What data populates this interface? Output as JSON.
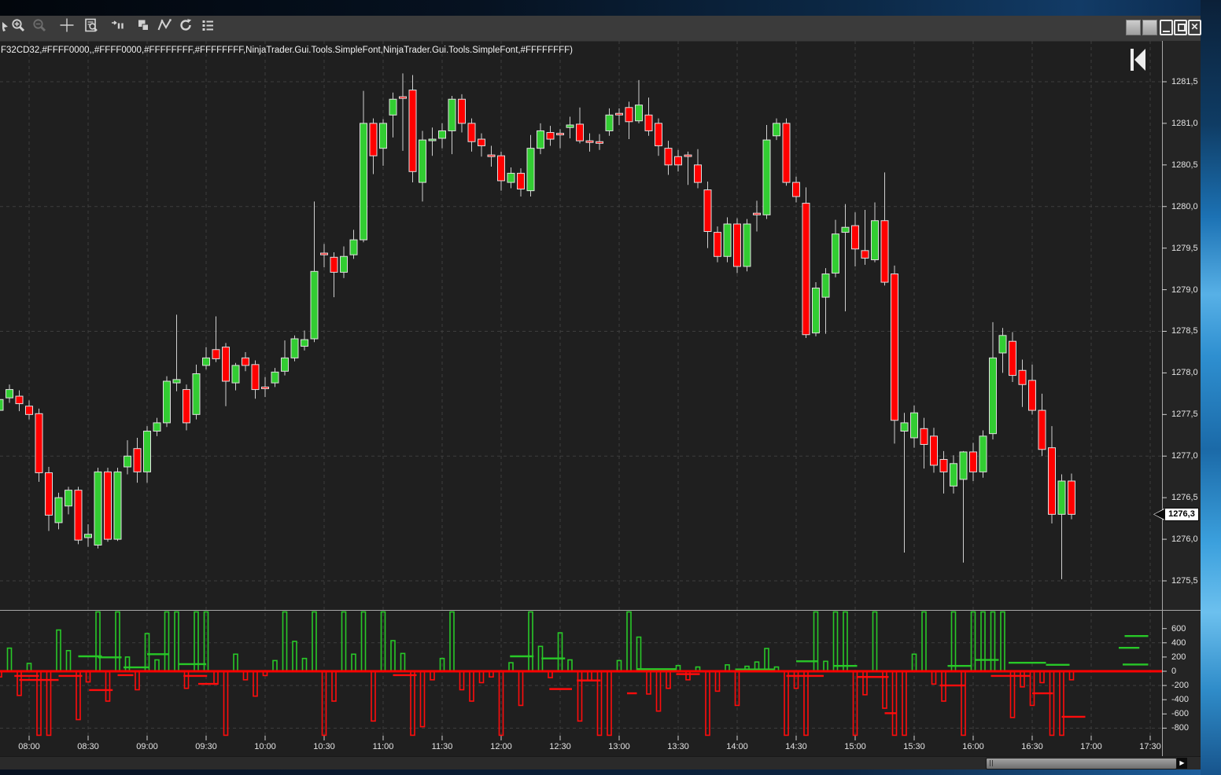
{
  "window": {
    "buttons": [
      {
        "name": "titlebar-button-1"
      },
      {
        "name": "titlebar-button-2"
      },
      {
        "name": "minimize"
      },
      {
        "name": "restore"
      },
      {
        "name": "close"
      }
    ]
  },
  "toolbar": {
    "icons": [
      {
        "name": "zoom-in",
        "disabled": false
      },
      {
        "name": "zoom-out",
        "disabled": true
      },
      {
        "name": "crosshair",
        "disabled": false
      },
      {
        "name": "chart-inspector",
        "disabled": false
      },
      {
        "name": "bar-period",
        "disabled": false
      },
      {
        "name": "windows-cascade",
        "disabled": false
      },
      {
        "name": "drawing-tools",
        "disabled": false
      },
      {
        "name": "reload",
        "disabled": false
      },
      {
        "name": "data-series",
        "disabled": false
      }
    ]
  },
  "chart": {
    "config_text": "F32CD32,#FFFF0000,,#FFFF0000,#FFFFFFFF,#FFFFFFFF,NinjaTrader.Gui.Tools.SimpleFont,NinjaTrader.Gui.Tools.SimpleFont,#FFFFFFFF)",
    "last_price_label": "1276,3"
  },
  "scrollbar": {
    "right_arrow_glyph": "▶"
  },
  "chart_data": {
    "type": "candlestick",
    "title": "",
    "decimal_separator": ",",
    "colors": {
      "up": "#32CD32",
      "down": "#FF0000",
      "outline": "#E0E0E0",
      "wick": "#CFCFCF",
      "delta_up": "#28C828",
      "delta_down": "#FF0C0C",
      "zero_line": "#FF0000",
      "grid": "#3E3E3E",
      "background": "#1F1F1F",
      "axis_text": "#E3E3E3"
    },
    "time_axis": {
      "labels": [
        "08:00",
        "08:30",
        "09:00",
        "09:30",
        "10:00",
        "10:30",
        "11:00",
        "11:30",
        "12:00",
        "12:30",
        "13:00",
        "13:30",
        "14:00",
        "14:30",
        "15:00",
        "15:30",
        "16:00",
        "16:30",
        "17:00",
        "17:30"
      ],
      "minor_step_minutes": 5
    },
    "price_axis": {
      "ticks": [
        1281.5,
        1281.0,
        1280.5,
        1280.0,
        1279.5,
        1279.0,
        1278.5,
        1278.0,
        1277.5,
        1277.0,
        1276.5,
        1276.0,
        1275.5
      ],
      "gridlines": [
        1281.5,
        1280.0,
        1278.5,
        1277.0,
        1275.5
      ],
      "last_price": 1276.3
    },
    "columns": [
      "time",
      "open",
      "high",
      "low",
      "close"
    ],
    "candles": [
      [
        "07:45",
        1277.55,
        1277.75,
        1277.48,
        1277.68
      ],
      [
        "07:50",
        1277.7,
        1277.86,
        1277.64,
        1277.8
      ],
      [
        "07:55",
        1277.72,
        1277.79,
        1277.54,
        1277.63
      ],
      [
        "08:00",
        1277.6,
        1277.67,
        1277.44,
        1277.5
      ],
      [
        "08:05",
        1277.51,
        1277.57,
        1276.69,
        1276.8
      ],
      [
        "08:10",
        1276.8,
        1276.87,
        1276.1,
        1276.29
      ],
      [
        "08:15",
        1276.2,
        1276.56,
        1276.12,
        1276.5
      ],
      [
        "08:20",
        1276.4,
        1276.63,
        1276.3,
        1276.59
      ],
      [
        "08:25",
        1276.59,
        1276.63,
        1275.94,
        1275.99
      ],
      [
        "08:30",
        1276.02,
        1276.18,
        1275.91,
        1276.06
      ],
      [
        "08:35",
        1275.93,
        1276.86,
        1275.89,
        1276.81
      ],
      [
        "08:40",
        1276.81,
        1276.86,
        1275.97,
        1276.0
      ],
      [
        "08:45",
        1276.0,
        1276.86,
        1275.98,
        1276.81
      ],
      [
        "08:50",
        1276.87,
        1277.19,
        1276.78,
        1277.0
      ],
      [
        "08:55",
        1277.09,
        1277.22,
        1276.68,
        1276.81
      ],
      [
        "09:00",
        1276.81,
        1277.36,
        1276.68,
        1277.3
      ],
      [
        "09:05",
        1277.3,
        1277.46,
        1277.24,
        1277.4
      ],
      [
        "09:10",
        1277.4,
        1277.96,
        1277.35,
        1277.9
      ],
      [
        "09:15",
        1277.88,
        1278.7,
        1277.78,
        1277.92
      ],
      [
        "09:20",
        1277.8,
        1277.86,
        1277.31,
        1277.4
      ],
      [
        "09:25",
        1277.5,
        1278.1,
        1277.44,
        1277.99
      ],
      [
        "09:30",
        1278.09,
        1278.31,
        1278.04,
        1278.18
      ],
      [
        "09:35",
        1278.28,
        1278.68,
        1278.13,
        1278.17
      ],
      [
        "09:40",
        1278.31,
        1278.36,
        1277.6,
        1277.9
      ],
      [
        "09:45",
        1277.88,
        1278.12,
        1277.79,
        1278.09
      ],
      [
        "09:50",
        1278.18,
        1278.25,
        1278.02,
        1278.09
      ],
      [
        "09:55",
        1278.1,
        1278.15,
        1277.69,
        1277.8
      ],
      [
        "10:00",
        1277.83,
        1277.95,
        1277.71,
        1277.81
      ],
      [
        "10:05",
        1277.88,
        1278.06,
        1277.83,
        1278.01
      ],
      [
        "10:10",
        1278.02,
        1278.39,
        1277.97,
        1278.18
      ],
      [
        "10:15",
        1278.18,
        1278.45,
        1278.14,
        1278.41
      ],
      [
        "10:20",
        1278.32,
        1278.51,
        1278.27,
        1278.4
      ],
      [
        "10:25",
        1278.41,
        1280.06,
        1278.37,
        1279.22
      ],
      [
        "10:30",
        1279.44,
        1279.55,
        1279.27,
        1279.42
      ],
      [
        "10:35",
        1279.39,
        1279.45,
        1278.91,
        1279.21
      ],
      [
        "10:40",
        1279.21,
        1279.52,
        1279.14,
        1279.4
      ],
      [
        "10:45",
        1279.42,
        1279.72,
        1279.37,
        1279.6
      ],
      [
        "10:50",
        1279.6,
        1281.39,
        1279.57,
        1281.0
      ],
      [
        "10:55",
        1281.0,
        1281.06,
        1280.39,
        1280.61
      ],
      [
        "11:00",
        1280.7,
        1281.05,
        1280.49,
        1281.0
      ],
      [
        "11:05",
        1281.1,
        1281.37,
        1280.83,
        1281.29
      ],
      [
        "11:10",
        1281.32,
        1281.6,
        1280.67,
        1281.3
      ],
      [
        "11:15",
        1281.4,
        1281.58,
        1280.29,
        1280.42
      ],
      [
        "11:20",
        1280.29,
        1280.91,
        1280.06,
        1280.8
      ],
      [
        "11:25",
        1280.8,
        1280.95,
        1280.61,
        1280.81
      ],
      [
        "11:30",
        1280.82,
        1281.0,
        1280.7,
        1280.91
      ],
      [
        "11:35",
        1280.91,
        1281.33,
        1280.63,
        1281.29
      ],
      [
        "11:40",
        1281.29,
        1281.35,
        1280.89,
        1281.0
      ],
      [
        "11:45",
        1281.0,
        1281.06,
        1280.66,
        1280.78
      ],
      [
        "11:50",
        1280.81,
        1280.88,
        1280.6,
        1280.73
      ],
      [
        "11:55",
        1280.62,
        1280.73,
        1280.48,
        1280.6
      ],
      [
        "12:00",
        1280.61,
        1280.66,
        1280.19,
        1280.31
      ],
      [
        "12:05",
        1280.29,
        1280.47,
        1280.22,
        1280.4
      ],
      [
        "12:10",
        1280.4,
        1280.46,
        1280.12,
        1280.21
      ],
      [
        "12:15",
        1280.19,
        1280.86,
        1280.12,
        1280.7
      ],
      [
        "12:20",
        1280.7,
        1281.0,
        1280.63,
        1280.91
      ],
      [
        "12:25",
        1280.89,
        1280.97,
        1280.73,
        1280.81
      ],
      [
        "12:30",
        1280.88,
        1280.93,
        1280.7,
        1280.87
      ],
      [
        "12:35",
        1280.95,
        1281.08,
        1280.82,
        1280.98
      ],
      [
        "12:40",
        1280.99,
        1281.19,
        1280.76,
        1280.79
      ],
      [
        "12:45",
        1280.79,
        1280.88,
        1280.66,
        1280.77
      ],
      [
        "12:50",
        1280.78,
        1280.87,
        1280.68,
        1280.76
      ],
      [
        "12:55",
        1280.91,
        1281.18,
        1280.85,
        1281.1
      ],
      [
        "13:00",
        1281.12,
        1281.18,
        1280.98,
        1281.11
      ],
      [
        "13:05",
        1281.19,
        1281.26,
        1280.81,
        1281.02
      ],
      [
        "13:10",
        1281.03,
        1281.52,
        1281.0,
        1281.22
      ],
      [
        "13:15",
        1281.1,
        1281.31,
        1280.85,
        1280.91
      ],
      [
        "13:20",
        1281.0,
        1281.06,
        1280.61,
        1280.73
      ],
      [
        "13:25",
        1280.7,
        1280.79,
        1280.38,
        1280.5
      ],
      [
        "13:30",
        1280.6,
        1280.68,
        1280.42,
        1280.5
      ],
      [
        "13:35",
        1280.62,
        1280.66,
        1280.26,
        1280.61
      ],
      [
        "13:40",
        1280.5,
        1280.69,
        1280.22,
        1280.29
      ],
      [
        "13:45",
        1280.2,
        1280.3,
        1279.5,
        1279.7
      ],
      [
        "13:50",
        1279.69,
        1279.76,
        1279.33,
        1279.4
      ],
      [
        "13:55",
        1279.4,
        1279.87,
        1279.33,
        1279.79
      ],
      [
        "14:00",
        1279.79,
        1279.86,
        1279.2,
        1279.28
      ],
      [
        "14:05",
        1279.28,
        1279.85,
        1279.22,
        1279.79
      ],
      [
        "14:10",
        1279.92,
        1280.07,
        1279.7,
        1279.9
      ],
      [
        "14:15",
        1279.9,
        1280.98,
        1279.85,
        1280.8
      ],
      [
        "14:20",
        1280.85,
        1281.06,
        1280.8,
        1281.0
      ],
      [
        "14:25",
        1281.0,
        1281.06,
        1280.25,
        1280.29
      ],
      [
        "14:30",
        1280.29,
        1280.36,
        1280.05,
        1280.12
      ],
      [
        "14:35",
        1280.04,
        1280.23,
        1278.42,
        1278.46
      ],
      [
        "14:40",
        1278.48,
        1279.09,
        1278.44,
        1279.02
      ],
      [
        "14:45",
        1278.91,
        1279.26,
        1278.47,
        1279.19
      ],
      [
        "14:50",
        1279.2,
        1279.84,
        1279.15,
        1279.67
      ],
      [
        "14:55",
        1279.69,
        1280.03,
        1278.74,
        1279.75
      ],
      [
        "15:00",
        1279.77,
        1279.93,
        1279.28,
        1279.49
      ],
      [
        "15:05",
        1279.47,
        1279.96,
        1279.3,
        1279.38
      ],
      [
        "15:10",
        1279.36,
        1280.05,
        1279.33,
        1279.83
      ],
      [
        "15:15",
        1279.83,
        1280.41,
        1279.05,
        1279.09
      ],
      [
        "15:20",
        1279.19,
        1279.29,
        1277.15,
        1277.43
      ],
      [
        "15:25",
        1277.3,
        1277.52,
        1275.84,
        1277.4
      ],
      [
        "15:30",
        1277.22,
        1277.61,
        1277.1,
        1277.52
      ],
      [
        "15:35",
        1277.33,
        1277.46,
        1276.85,
        1277.14
      ],
      [
        "15:40",
        1277.24,
        1277.34,
        1276.8,
        1276.89
      ],
      [
        "15:45",
        1276.96,
        1277.06,
        1276.55,
        1276.81
      ],
      [
        "15:50",
        1276.64,
        1277.01,
        1276.55,
        1276.91
      ],
      [
        "15:55",
        1276.72,
        1277.06,
        1275.72,
        1277.05
      ],
      [
        "16:00",
        1277.05,
        1277.16,
        1276.7,
        1276.81
      ],
      [
        "16:05",
        1276.81,
        1277.31,
        1276.74,
        1277.24
      ],
      [
        "16:10",
        1277.27,
        1278.61,
        1277.2,
        1278.18
      ],
      [
        "16:15",
        1278.24,
        1278.54,
        1278.0,
        1278.45
      ],
      [
        "16:20",
        1278.38,
        1278.49,
        1277.89,
        1277.97
      ],
      [
        "16:25",
        1278.03,
        1278.16,
        1277.59,
        1277.86
      ],
      [
        "16:30",
        1277.91,
        1278.1,
        1277.5,
        1277.55
      ],
      [
        "16:35",
        1277.55,
        1277.75,
        1277.0,
        1277.08
      ],
      [
        "16:40",
        1277.1,
        1277.36,
        1276.19,
        1276.3
      ],
      [
        "16:45",
        1276.3,
        1276.78,
        1275.52,
        1276.7
      ],
      [
        "16:50",
        1276.7,
        1276.79,
        1276.24,
        1276.3
      ]
    ],
    "lower_panel": {
      "type": "delta-bars",
      "ticks": [
        600,
        400,
        200,
        0,
        -200,
        -400,
        -600,
        -800
      ],
      "gridlines": [
        400,
        -200,
        -800
      ],
      "clip_value": 900,
      "values": [
        -80,
        325,
        -340,
        110,
        -900,
        -900,
        580,
        290,
        -680,
        -150,
        900,
        -420,
        900,
        200,
        -260,
        530,
        160,
        900,
        900,
        -240,
        900,
        900,
        -180,
        -900,
        240,
        -120,
        -350,
        -60,
        150,
        900,
        420,
        180,
        900,
        -900,
        -420,
        900,
        240,
        900,
        -700,
        900,
        430,
        250,
        -900,
        -780,
        -120,
        180,
        900,
        -260,
        -420,
        -160,
        -80,
        -900,
        120,
        -480,
        900,
        350,
        -90,
        540,
        160,
        -700,
        -130,
        -900,
        -900,
        150,
        900,
        480,
        -320,
        -560,
        -240,
        80,
        -120,
        60,
        -900,
        -280,
        90,
        -480,
        70,
        130,
        320,
        60,
        -900,
        -240,
        -900,
        900,
        140,
        900,
        900,
        -900,
        -330,
        900,
        -520,
        -900,
        -900,
        240,
        900,
        -180,
        -420,
        900,
        -900,
        900,
        900,
        900,
        900,
        -650,
        -220,
        -480,
        -160,
        -900,
        -900,
        -120
      ],
      "segments": [
        [
          1.5,
          4.0,
          -66
        ],
        [
          2.0,
          6.0,
          -122
        ],
        [
          6.0,
          8.4,
          -66
        ],
        [
          9.1,
          11.5,
          -265
        ],
        [
          12.0,
          13.6,
          -55
        ],
        [
          18.7,
          21.1,
          -66
        ],
        [
          20.2,
          22.2,
          -177
        ],
        [
          8.0,
          10.4,
          210
        ],
        [
          10.0,
          12.4,
          195
        ],
        [
          12.6,
          15.2,
          55
        ],
        [
          15.0,
          17.2,
          240
        ],
        [
          18.2,
          21.0,
          100
        ],
        [
          40.0,
          42.4,
          -55
        ],
        [
          51.9,
          54.3,
          210
        ],
        [
          55.1,
          57.5,
          180
        ],
        [
          55.9,
          58.2,
          -250
        ],
        [
          58.7,
          61.1,
          -130
        ],
        [
          63.8,
          64.8,
          -310
        ],
        [
          64.8,
          68.8,
          30
        ],
        [
          68.8,
          71.2,
          -40
        ],
        [
          74.8,
          78.8,
          25
        ],
        [
          80.0,
          83.8,
          -66
        ],
        [
          81.0,
          83.2,
          140
        ],
        [
          84.8,
          87.2,
          75
        ],
        [
          87.2,
          90.4,
          -80
        ],
        [
          90.0,
          91.2,
          -590
        ],
        [
          95.6,
          98.2,
          -200
        ],
        [
          96.4,
          98.8,
          75
        ],
        [
          99.2,
          101.6,
          160
        ],
        [
          100.8,
          104.8,
          -66
        ],
        [
          102.6,
          106.4,
          120
        ],
        [
          105.0,
          107.1,
          -310
        ],
        [
          108.0,
          110.4,
          -640
        ],
        [
          106.4,
          108.8,
          90
        ],
        [
          114.4,
          116.8,
          495
        ],
        [
          113.8,
          115.9,
          330
        ],
        [
          114.2,
          116.8,
          95
        ]
      ]
    }
  }
}
